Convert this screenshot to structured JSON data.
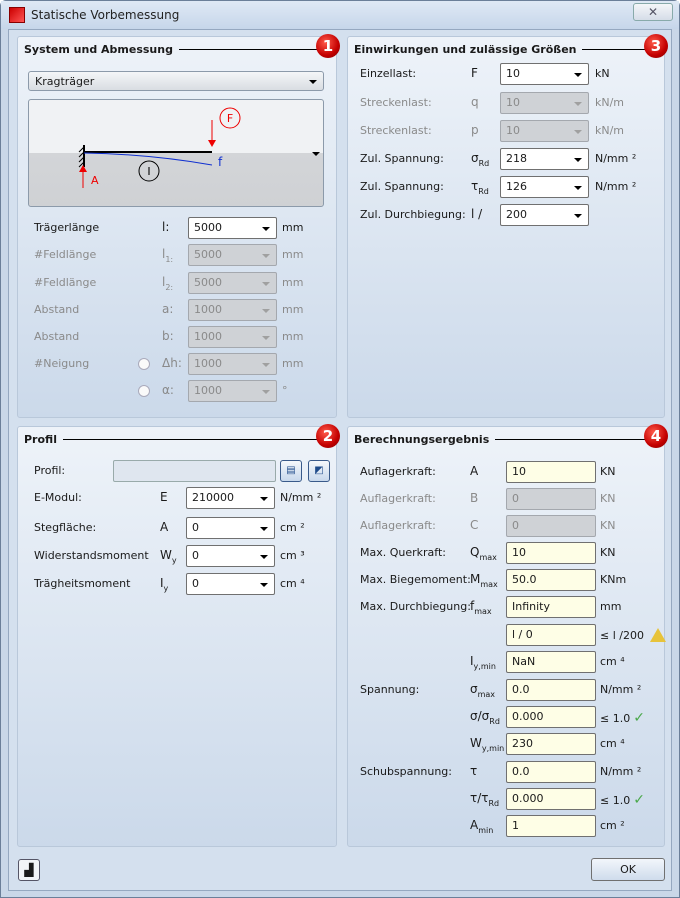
{
  "window": {
    "title": "Statische Vorbemessung",
    "close_label": "✕"
  },
  "system": {
    "title": "System und Abmessung",
    "badge": "1",
    "type_value": "Kragträger",
    "diagram": {
      "force_label": "F",
      "support_label": "A",
      "deflection_label": "f",
      "inertia_label": "I"
    },
    "rows": [
      {
        "label": "Trägerlänge",
        "sym": "l:",
        "sub": "",
        "value": "5000",
        "unit": "mm",
        "disabled": false,
        "kind": "sel"
      },
      {
        "label": "#Feldlänge",
        "sym": "l",
        "sub": "1:",
        "value": "5000",
        "unit": "mm",
        "disabled": true,
        "kind": "sel"
      },
      {
        "label": "#Feldlänge",
        "sym": "l",
        "sub": "2:",
        "value": "5000",
        "unit": "mm",
        "disabled": true,
        "kind": "sel"
      },
      {
        "label": "Abstand",
        "sym": "a:",
        "sub": "",
        "value": "1000",
        "unit": "mm",
        "disabled": true,
        "kind": "sel"
      },
      {
        "label": "Abstand",
        "sym": "b:",
        "sub": "",
        "value": "1000",
        "unit": "mm",
        "disabled": true,
        "kind": "sel"
      },
      {
        "label": "#Neigung",
        "sym": "Δh:",
        "sub": "",
        "value": "1000",
        "unit": "mm",
        "disabled": true,
        "kind": "sel",
        "radio": true
      },
      {
        "label": "",
        "sym": "α:",
        "sub": "",
        "value": "1000",
        "unit": "°",
        "disabled": true,
        "kind": "sel",
        "radio": true
      }
    ]
  },
  "loads": {
    "title": "Einwirkungen und zulässige Größen",
    "badge": "3",
    "rows": [
      {
        "label": "Einzellast:",
        "sym": "F",
        "sub": "",
        "value": "10",
        "unit": "kN",
        "disabled": false,
        "kind": "sel"
      },
      {
        "label": "Streckenlast:",
        "sym": "q",
        "sub": "",
        "value": "10",
        "unit": "kN/m",
        "disabled": true,
        "kind": "sel"
      },
      {
        "label": "Streckenlast:",
        "sym": "p",
        "sub": "",
        "value": "10",
        "unit": "kN/m",
        "disabled": true,
        "kind": "sel"
      },
      {
        "label": "Zul. Spannung:",
        "sym": "σ",
        "sub": "Rd",
        "value": "218",
        "unit": "N/mm ²",
        "disabled": false,
        "kind": "sel"
      },
      {
        "label": "Zul. Spannung:",
        "sym": "τ",
        "sub": "Rd",
        "value": "126",
        "unit": "N/mm ²",
        "disabled": false,
        "kind": "sel"
      },
      {
        "label": "Zul. Durchbiegung:",
        "sym": "l /",
        "sub": "",
        "value": "200",
        "unit": "",
        "disabled": false,
        "kind": "sel"
      }
    ]
  },
  "profile": {
    "title": "Profil",
    "badge": "2",
    "profile_label": "Profil:",
    "profile_value": "",
    "library_icon": "catalog-icon",
    "edit_icon": "profile-edit-icon",
    "rows": [
      {
        "label": "E-Modul:",
        "sym": "E",
        "sub": "",
        "value": "210000",
        "unit": "N/mm ²",
        "disabled": false,
        "kind": "sel"
      },
      {
        "label": "Stegfläche:",
        "sym": "A",
        "sub": "",
        "value": "0",
        "unit": "cm ²",
        "disabled": false,
        "kind": "sel"
      },
      {
        "label": "Widerstandsmoment",
        "sym": "W",
        "sub": "y",
        "value": "0",
        "unit": "cm ³",
        "disabled": false,
        "kind": "sel"
      },
      {
        "label": "Trägheitsmoment",
        "sym": "I",
        "sub": "y",
        "value": "0",
        "unit": "cm ⁴",
        "disabled": false,
        "kind": "sel"
      }
    ]
  },
  "results": {
    "title": "Berechnungsergebnis",
    "badge": "4",
    "rows": [
      {
        "label": "Auflagerkraft:",
        "sym": "A",
        "sub": "",
        "value": "10",
        "unit": "KN",
        "disabled": false,
        "kind": "res"
      },
      {
        "label": "Auflagerkraft:",
        "sym": "B",
        "sub": "",
        "value": "0",
        "unit": "KN",
        "disabled": true,
        "kind": "res"
      },
      {
        "label": "Auflagerkraft:",
        "sym": "C",
        "sub": "",
        "value": "0",
        "unit": "KN",
        "disabled": true,
        "kind": "res"
      },
      {
        "label": "Max. Querkraft:",
        "sym": "Q",
        "sub": "max",
        "value": "10",
        "unit": "KN",
        "disabled": false,
        "kind": "res"
      },
      {
        "label": "Max. Biegemoment:",
        "sym": "M",
        "sub": "max",
        "value": "50.0",
        "unit": "KNm",
        "disabled": false,
        "kind": "res"
      },
      {
        "label": "Max. Durchbiegung:",
        "sym": "f",
        "sub": "max",
        "value": "Infinity",
        "unit": "mm",
        "disabled": false,
        "kind": "res"
      },
      {
        "label": "",
        "sym": "",
        "sub": "",
        "value": "l / 0",
        "unit": "≤ l /200",
        "disabled": false,
        "kind": "res",
        "status": "warning"
      },
      {
        "label": "",
        "sym": "I",
        "sub": "y,min",
        "value": "NaN",
        "unit": "cm ⁴",
        "disabled": false,
        "kind": "res"
      },
      {
        "label": "Spannung:",
        "sym": "σ",
        "sub": "max",
        "value": "0.0",
        "unit": "N/mm ²",
        "disabled": false,
        "kind": "res"
      },
      {
        "label": "",
        "sym": "σ/σ",
        "sub": "Rd",
        "value": "0.000",
        "unit": "≤ 1.0",
        "disabled": false,
        "kind": "res",
        "status": "ok"
      },
      {
        "label": "",
        "sym": "W",
        "sub": "y,min",
        "value": "230",
        "unit": "cm ⁴",
        "disabled": false,
        "kind": "res"
      },
      {
        "label": "Schubspannung:",
        "sym": "τ",
        "sub": "",
        "value": "0.0",
        "unit": "N/mm ²",
        "disabled": false,
        "kind": "res"
      },
      {
        "label": "",
        "sym": "τ/τ",
        "sub": "Rd",
        "value": "0.000",
        "unit": "≤ 1.0",
        "disabled": false,
        "kind": "res",
        "status": "ok"
      },
      {
        "label": "",
        "sym": "A",
        "sub": "min",
        "value": "1",
        "unit": "cm ²",
        "disabled": false,
        "kind": "res"
      }
    ]
  },
  "footer": {
    "ok_label": "OK",
    "status_icon": "report-icon"
  },
  "colors": {
    "badge": "#c40000",
    "result_field": "#fefee6",
    "ok_check": "#4aa84a",
    "warning": "#e7c33a"
  }
}
